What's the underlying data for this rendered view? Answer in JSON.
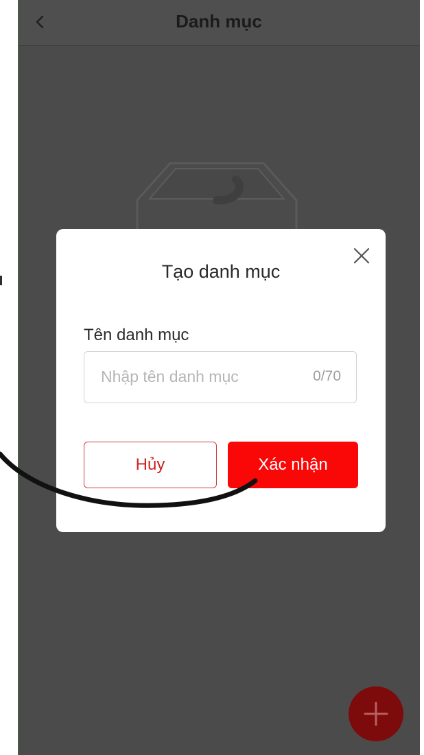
{
  "header": {
    "title": "Danh mục",
    "back_icon": "chevron-left-icon"
  },
  "dialog": {
    "title": "Tạo danh mục",
    "close_icon": "close-icon",
    "field": {
      "label": "Tên danh mục",
      "value": "",
      "placeholder": "Nhập tên danh mục",
      "counter": "0/70"
    },
    "buttons": {
      "cancel_label": "Hủy",
      "confirm_label": "Xác nhận"
    }
  },
  "fab": {
    "icon": "plus-icon"
  },
  "colors": {
    "accent": "#fa0707",
    "cancel_text": "#d01f1f",
    "fab_dimmed": "#7d0b0b",
    "overlay_bg": "#4b4b4b"
  }
}
